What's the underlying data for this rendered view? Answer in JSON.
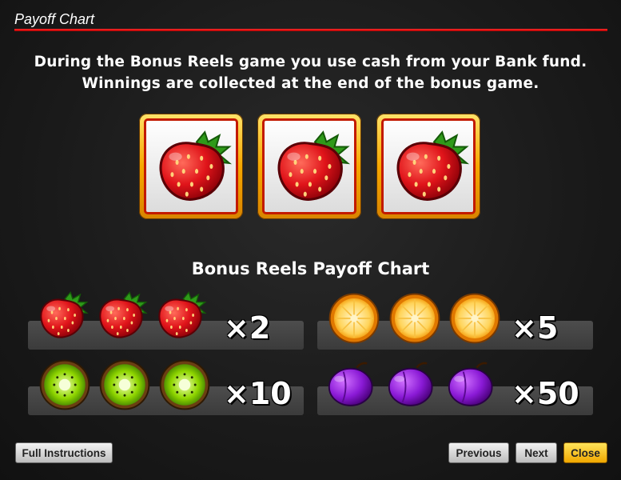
{
  "header": {
    "title": "Payoff Chart"
  },
  "intro": {
    "line1": "During the Bonus Reels game you use cash from your Bank fund.",
    "line2": "Winnings are collected at the end of the bonus game."
  },
  "reels": [
    "strawberry-icon",
    "strawberry-icon",
    "strawberry-icon"
  ],
  "chart": {
    "title": "Bonus Reels Payoff Chart",
    "rows": [
      {
        "symbol": "strawberry-icon",
        "multiplier": "×2"
      },
      {
        "symbol": "orange-icon",
        "multiplier": "×5"
      },
      {
        "symbol": "kiwi-icon",
        "multiplier": "×10"
      },
      {
        "symbol": "plum-icon",
        "multiplier": "×50"
      }
    ]
  },
  "buttons": {
    "full_instructions": "Full Instructions",
    "previous": "Previous",
    "next": "Next",
    "close": "Close"
  },
  "colors": {
    "accent_red": "#e00000",
    "reel_gold": "#f6a800",
    "close_yellow": "#ffd21e"
  }
}
